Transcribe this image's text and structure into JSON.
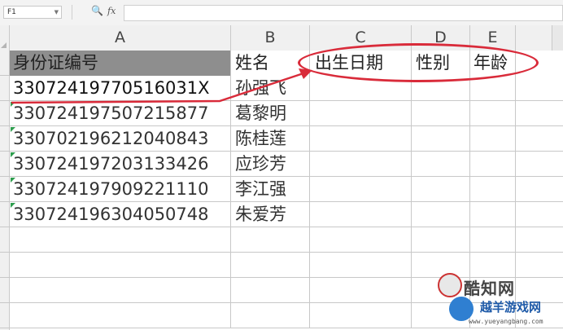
{
  "formula_bar": {
    "cell_ref": "F1",
    "fx_label": "fx",
    "formula_value": ""
  },
  "columns": [
    "A",
    "B",
    "C",
    "D",
    "E"
  ],
  "header_row": [
    "身份证编号",
    "姓名",
    "出生日期",
    "性别",
    "年龄"
  ],
  "rows": [
    {
      "id": "33072419770516031X",
      "name": "孙强飞"
    },
    {
      "id": "330724197507215877",
      "name": "葛黎明"
    },
    {
      "id": "330702196212040843",
      "name": "陈桂莲"
    },
    {
      "id": "330724197203133426",
      "name": "应珍芳"
    },
    {
      "id": "330724197909221110",
      "name": "李江强"
    },
    {
      "id": "330724196304050748",
      "name": "朱爱芳"
    }
  ],
  "annotation_color": "#d92b3a",
  "header_fill": "#8e8e8e",
  "watermark": {
    "line1": "酷知网",
    "line2": "越羊游戏网",
    "line3": "www.yueyangbang.com"
  }
}
